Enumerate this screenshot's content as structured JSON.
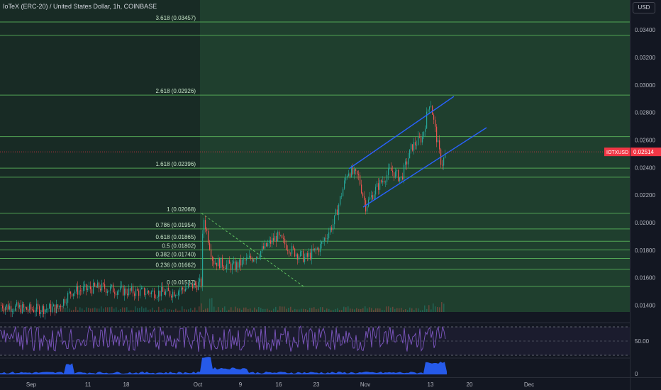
{
  "header": {
    "title": "IoTeX (ERC-20) / United States Dollar, 1h, COINBASE",
    "currency_button": "USD"
  },
  "colors": {
    "background": "#131722",
    "fib_zone": "#1e3a2a",
    "fib_line": "#5fbf5f",
    "channel": "#2962ff",
    "candle_up": "#26a69a",
    "candle_down": "#ef5350",
    "rsi": "#7e57c2",
    "volume_area": "#2962ff",
    "price_tag": "#f23645"
  },
  "current_price": {
    "symbol": "IOTXUSD",
    "value": "0.02514",
    "level": 0.02514
  },
  "price_axis": {
    "ticks": [
      "0.03400",
      "0.03200",
      "0.03000",
      "0.02800",
      "0.02600",
      "0.02400",
      "0.02200",
      "0.02000",
      "0.01800",
      "0.01600",
      "0.01400"
    ],
    "tick_values": [
      0.034,
      0.032,
      0.03,
      0.028,
      0.026,
      0.024,
      0.022,
      0.02,
      0.018,
      0.016,
      0.014
    ],
    "rsi_ticks": [
      "50.00"
    ],
    "volume_ticks": [
      "0"
    ]
  },
  "time_axis": {
    "labels": [
      "Sep",
      "11",
      "18",
      "Oct",
      "9",
      "16",
      "23",
      "Nov",
      "13",
      "20",
      "Dec"
    ]
  },
  "fib_levels": [
    {
      "ratio": "3.618",
      "label": "3.618 (0.03457)",
      "value": 0.03457
    },
    {
      "ratio": "2.618",
      "label": "2.618 (0.02926)",
      "value": 0.02926
    },
    {
      "ratio": "1.618",
      "label": "1.618 (0.02396)",
      "value": 0.02396
    },
    {
      "ratio": "1",
      "label": "1 (0.02068)",
      "value": 0.02068
    },
    {
      "ratio": "0.786",
      "label": "0.786 (0.01954)",
      "value": 0.01954
    },
    {
      "ratio": "0.618",
      "label": "0.618 (0.01865)",
      "value": 0.01865
    },
    {
      "ratio": "0.5",
      "label": "0.5 (0.01802)",
      "value": 0.01802
    },
    {
      "ratio": "0.382",
      "label": "0.382 (0.01740)",
      "value": 0.0174
    },
    {
      "ratio": "0.236",
      "label": "0.236 (0.01662)",
      "value": 0.01662
    },
    {
      "ratio": "0",
      "label": "0 (0.01537)",
      "value": 0.01537
    }
  ]
}
